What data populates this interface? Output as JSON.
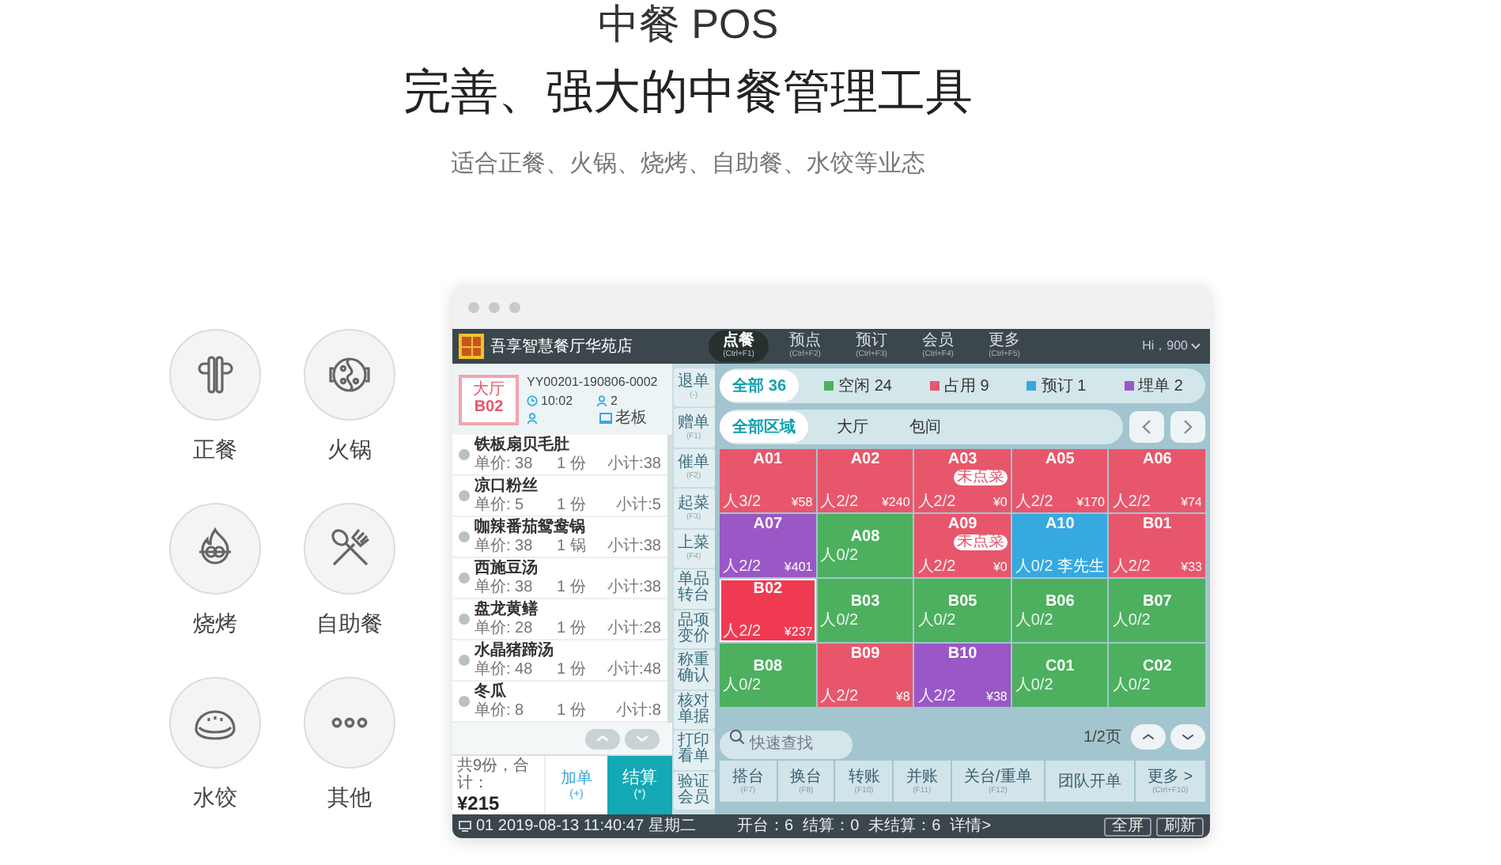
{
  "header": {
    "title": "中餐 POS",
    "headline": "完善、强大的中餐管理工具",
    "subtitle": "适合正餐、火锅、烧烤、自助餐、水饺等业态"
  },
  "categories": [
    {
      "kind": "chopsticks",
      "label": "正餐"
    },
    {
      "kind": "hotpot",
      "label": "火锅"
    },
    {
      "kind": "bbq",
      "label": "烧烤"
    },
    {
      "kind": "cutlery",
      "label": "自助餐"
    },
    {
      "kind": "dumpling",
      "label": "水饺"
    },
    {
      "kind": "more",
      "label": "其他"
    }
  ],
  "pos": {
    "store_name": "吾享智慧餐厅华苑店",
    "nav": [
      {
        "label": "点餐",
        "hint": "(Ctrl+F1)",
        "selected": true
      },
      {
        "label": "预点",
        "hint": "(Ctrl+F2)",
        "selected": false
      },
      {
        "label": "预订",
        "hint": "(Ctrl+F3)",
        "selected": false
      },
      {
        "label": "会员",
        "hint": "(Ctrl+F4)",
        "selected": false
      },
      {
        "label": "更多",
        "hint": "(Ctrl+F5)",
        "selected": false
      }
    ],
    "user": "Hi，900",
    "order": {
      "area": "大厅",
      "table": "B02",
      "number": "YY00201-190806-0002",
      "time": "10:02",
      "guests": "2",
      "staff": "老板"
    },
    "items": [
      {
        "name": "铁板扇贝毛肚",
        "unit_price": "单价: 38",
        "qty": "1 份",
        "subtotal": "小计:38"
      },
      {
        "name": "凉口粉丝",
        "unit_price": "单价: 5",
        "qty": "1 份",
        "subtotal": "小计:5"
      },
      {
        "name": "咖辣番茄鸳鸯锅",
        "unit_price": "单价: 38",
        "qty": "1 锅",
        "subtotal": "小计:38"
      },
      {
        "name": "西施豆汤",
        "unit_price": "单价: 38",
        "qty": "1 份",
        "subtotal": "小计:38"
      },
      {
        "name": "盘龙黄鳝",
        "unit_price": "单价: 28",
        "qty": "1 份",
        "subtotal": "小计:28"
      },
      {
        "name": "水晶猪蹄汤",
        "unit_price": "单价: 48",
        "qty": "1 份",
        "subtotal": "小计:48"
      },
      {
        "name": "冬瓜",
        "unit_price": "单价: 8",
        "qty": "1 份",
        "subtotal": "小计:8"
      }
    ],
    "summary": {
      "label": "共9份，合计：",
      "total": "¥215"
    },
    "add_button": {
      "label": "加单",
      "hint": "(+)"
    },
    "checkout_button": {
      "label": "结算",
      "hint": "(*)"
    },
    "side_actions": [
      {
        "label": "退单",
        "hint": "(-)"
      },
      {
        "label": "赠单",
        "hint": "(F1)"
      },
      {
        "label": "催单",
        "hint": "(F2)"
      },
      {
        "label": "起菜",
        "hint": "(F3)"
      },
      {
        "label": "上菜",
        "hint": "(F4)"
      },
      {
        "label": "单品转台"
      },
      {
        "label": "品项变价"
      },
      {
        "label": "称重确认"
      },
      {
        "label": "核对单据"
      },
      {
        "label": "打印看单"
      },
      {
        "label": "验证会员"
      }
    ],
    "status_filters": [
      {
        "label": "全部 36",
        "selected": true
      },
      {
        "label": "空闲 24",
        "color": "#4cb05e",
        "selected": false
      },
      {
        "label": "占用 9",
        "color": "#e8566b",
        "selected": false
      },
      {
        "label": "预订 1",
        "color": "#35a9e0",
        "selected": false
      },
      {
        "label": "埋单 2",
        "color": "#9a57c6",
        "selected": false
      }
    ],
    "areas": [
      {
        "label": "全部区域",
        "selected": true
      },
      {
        "label": "大厅",
        "selected": false
      },
      {
        "label": "包间",
        "selected": false
      }
    ],
    "tables": [
      {
        "name": "A01",
        "kind": "occupied",
        "guests": "人3/2",
        "amount": "¥58",
        "selected": false
      },
      {
        "name": "A02",
        "kind": "occupied",
        "guests": "人2/2",
        "amount": "¥240",
        "selected": false
      },
      {
        "name": "A03",
        "kind": "occupied",
        "badge": "未点菜",
        "guests": "人2/2",
        "amount": "¥0",
        "selected": false
      },
      {
        "name": "A05",
        "kind": "occupied",
        "guests": "人2/2",
        "amount": "¥170",
        "selected": false
      },
      {
        "name": "A06",
        "kind": "occupied",
        "guests": "人2/2",
        "amount": "¥74",
        "selected": false
      },
      {
        "name": "A07",
        "kind": "billed",
        "guests": "人2/2",
        "amount": "¥401",
        "selected": false
      },
      {
        "name": "A08",
        "kind": "idle",
        "guests": "人0/2",
        "selected": false
      },
      {
        "name": "A09",
        "kind": "occupied",
        "badge": "未点菜",
        "guests": "人2/2",
        "amount": "¥0",
        "selected": false
      },
      {
        "name": "A10",
        "kind": "reserved",
        "guests": "人0/2",
        "customer": "李先生",
        "selected": false
      },
      {
        "name": "B01",
        "kind": "occupied",
        "guests": "人2/2",
        "amount": "¥33",
        "selected": false
      },
      {
        "name": "B02",
        "kind": "occupied",
        "guests": "人2/2",
        "amount": "¥237",
        "selected": true
      },
      {
        "name": "B03",
        "kind": "idle",
        "guests": "人0/2",
        "selected": false
      },
      {
        "name": "B05",
        "kind": "idle",
        "guests": "人0/2",
        "selected": false
      },
      {
        "name": "B06",
        "kind": "idle",
        "guests": "人0/2",
        "selected": false
      },
      {
        "name": "B07",
        "kind": "idle",
        "guests": "人0/2",
        "selected": false
      },
      {
        "name": "B08",
        "kind": "idle",
        "guests": "人0/2",
        "selected": false
      },
      {
        "name": "B09",
        "kind": "occupied",
        "guests": "人2/2",
        "amount": "¥8",
        "selected": false
      },
      {
        "name": "B10",
        "kind": "billed",
        "guests": "人2/2",
        "amount": "¥38",
        "selected": false
      },
      {
        "name": "C01",
        "kind": "idle",
        "guests": "人0/2",
        "selected": false
      },
      {
        "name": "C02",
        "kind": "idle",
        "guests": "人0/2",
        "selected": false
      }
    ],
    "search": {
      "placeholder": "快速查找"
    },
    "page": "1/2页",
    "actions": [
      {
        "label": "搭台",
        "hint": "(F7)"
      },
      {
        "label": "换台",
        "hint": "(F8)"
      },
      {
        "label": "转账",
        "hint": "(F10)"
      },
      {
        "label": "并账",
        "hint": "(F11)"
      },
      {
        "label": "关台/重单",
        "hint": "(F12)"
      },
      {
        "label": "团队开单"
      },
      {
        "label": "更多 >",
        "hint": "(Ctrl+F10)"
      }
    ],
    "footer": {
      "terminal": "01 2019-08-13 11:40:47 星期二",
      "stats": [
        "开台：6",
        "结算：0",
        "未结算：6"
      ],
      "details": "详情>",
      "buttons": [
        "全屏",
        "刷新"
      ]
    }
  }
}
